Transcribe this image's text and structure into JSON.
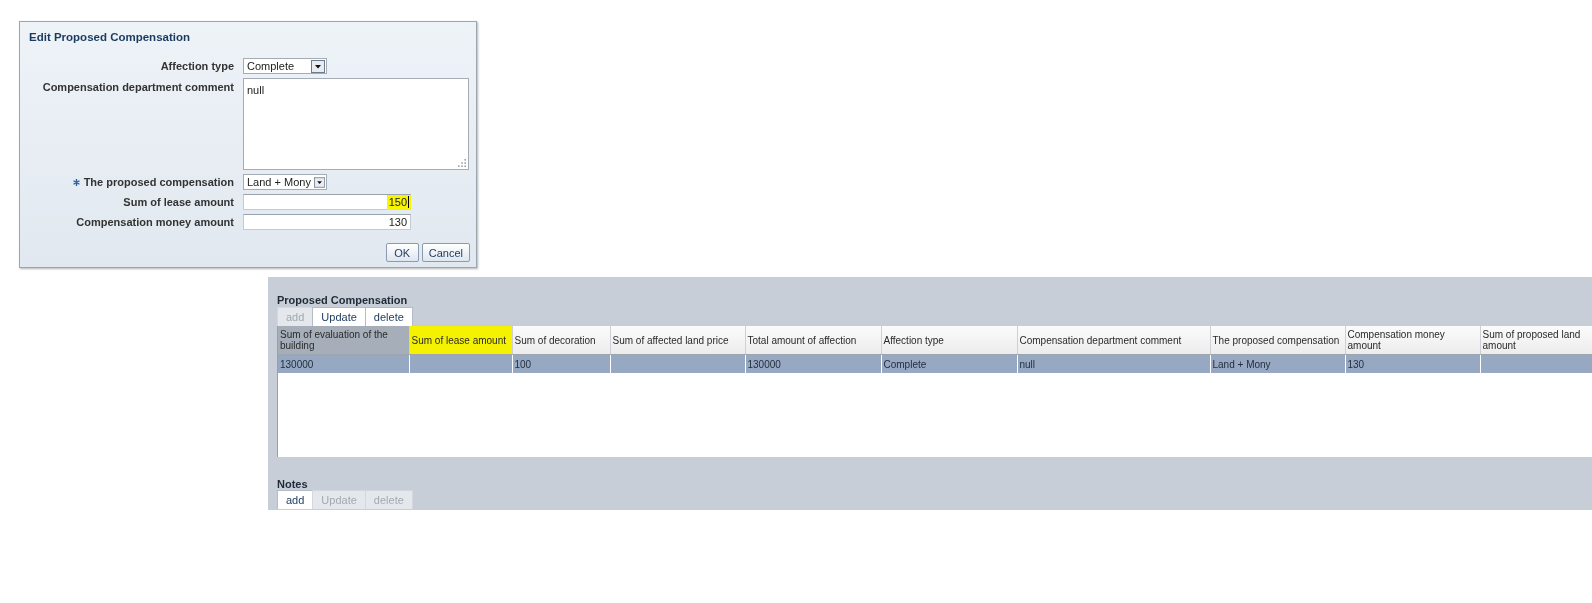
{
  "dialog": {
    "title": "Edit Proposed Compensation",
    "fields": [
      {
        "kind": "select",
        "label": "Affection type",
        "value": "Complete",
        "required": false,
        "highlighted": false,
        "focused": false
      },
      {
        "kind": "textarea",
        "label": "Compensation department comment",
        "value": "null",
        "required": false,
        "highlighted": false,
        "focused": false
      },
      {
        "kind": "select",
        "label": "The proposed compensation",
        "value": "Land + Mony",
        "required": true,
        "highlighted": false,
        "focused": false
      },
      {
        "kind": "text",
        "label": "Sum of lease amount",
        "value": "150",
        "required": false,
        "highlighted": true,
        "focused": true
      },
      {
        "kind": "text",
        "label": "Compensation money amount",
        "value": "130",
        "required": false,
        "highlighted": false,
        "focused": false
      }
    ],
    "buttons": [
      {
        "label": "OK"
      },
      {
        "label": "Cancel"
      }
    ]
  },
  "panels": [
    {
      "title": "Proposed Compensation",
      "toolbar": [
        {
          "label": "add",
          "disabled": true
        },
        {
          "label": "Update",
          "disabled": false
        },
        {
          "label": "delete",
          "disabled": false
        }
      ],
      "table": {
        "columns": [
          {
            "label": "Sum of evaluation of the building",
            "selected": true,
            "highlighted": false
          },
          {
            "label": "Sum of lease amount",
            "selected": false,
            "highlighted": true
          },
          {
            "label": "Sum of decoration",
            "selected": false,
            "highlighted": false
          },
          {
            "label": "Sum of affected land price",
            "selected": false,
            "highlighted": false
          },
          {
            "label": "Total amount of affection",
            "selected": false,
            "highlighted": false
          },
          {
            "label": "Affection type",
            "selected": false,
            "highlighted": false
          },
          {
            "label": "Compensation department comment",
            "selected": false,
            "highlighted": false
          },
          {
            "label": "The proposed compensation",
            "selected": false,
            "highlighted": false
          },
          {
            "label": "Compensation money amount",
            "selected": false,
            "highlighted": false
          },
          {
            "label": "Sum of proposed land amount",
            "selected": false,
            "highlighted": false
          }
        ],
        "rows": [
          {
            "selected": true,
            "cells": [
              "130000",
              null,
              "100",
              null,
              "130000",
              "Complete",
              "null",
              "Land + Mony",
              "130",
              null
            ]
          }
        ]
      }
    },
    {
      "title": "Notes",
      "toolbar": [
        {
          "label": "add",
          "disabled": false
        },
        {
          "label": "Update",
          "disabled": true
        },
        {
          "label": "delete",
          "disabled": true
        }
      ]
    }
  ]
}
